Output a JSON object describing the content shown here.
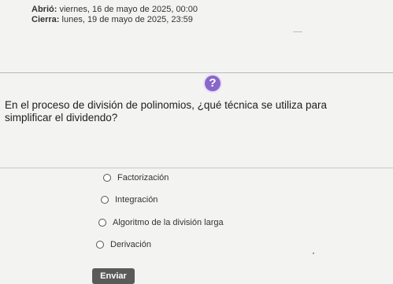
{
  "header": {
    "open_label": "Abrió:",
    "open_value": "viernes, 16 de mayo de 2025, 00:00",
    "close_label": "Cierra:",
    "close_value": "lunes, 19 de mayo de 2025, 23:59"
  },
  "help_icon": {
    "glyph": "?",
    "name": "help-icon",
    "color": "#8a66c9"
  },
  "question": {
    "text": "En el proceso de división de polinomios, ¿qué técnica se utiliza para simplificar el dividendo?"
  },
  "options": [
    {
      "label": "Factorización",
      "selected": false
    },
    {
      "label": "Integración",
      "selected": false
    },
    {
      "label": "Algoritmo de la división larga",
      "selected": false
    },
    {
      "label": "Derivación",
      "selected": false
    }
  ],
  "submit": {
    "label": "Enviar",
    "color": "#5a5a5a"
  }
}
